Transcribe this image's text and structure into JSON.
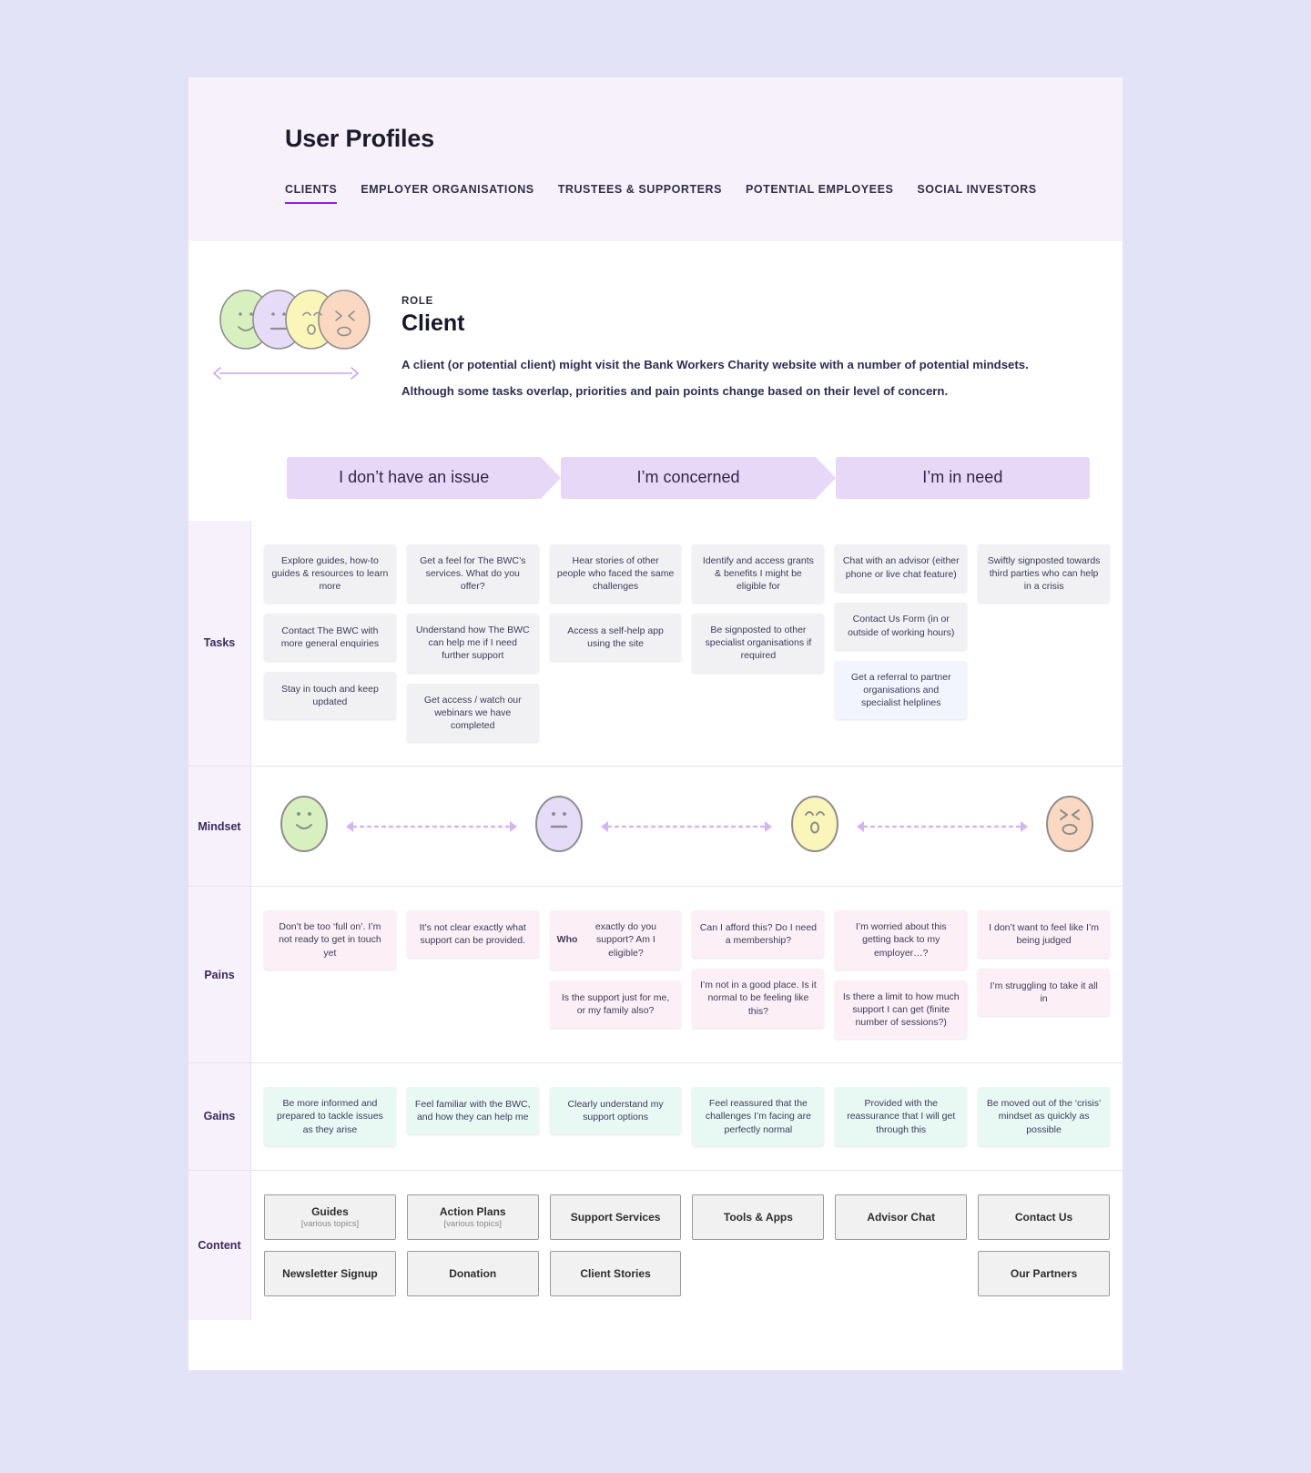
{
  "header": {
    "title": "User Profiles",
    "tabs": [
      {
        "label": "CLIENTS",
        "active": true
      },
      {
        "label": "EMPLOYER ORGANISATIONS",
        "active": false
      },
      {
        "label": "TRUSTEES & SUPPORTERS",
        "active": false
      },
      {
        "label": "POTENTIAL EMPLOYEES",
        "active": false
      },
      {
        "label": "SOCIAL INVESTORS",
        "active": false
      }
    ]
  },
  "role": {
    "kicker": "ROLE",
    "name": "Client",
    "description_line1": "A client (or potential client) might visit the Bank Workers Charity website with a number of potential mindsets.",
    "description_line2": "Although some tasks overlap, priorities and pain points change based on their level of concern."
  },
  "stages": [
    {
      "label": "I don’t have an issue"
    },
    {
      "label": "I’m concerned"
    },
    {
      "label": "I’m in need"
    }
  ],
  "rows": {
    "tasks_label": "Tasks",
    "mindset_label": "Mindset",
    "pains_label": "Pains",
    "gains_label": "Gains",
    "content_label": "Content"
  },
  "tasks": [
    [
      "Explore guides, how-to guides & resources to learn more",
      "Contact The BWC with more general enquiries",
      "Stay in touch and keep updated"
    ],
    [
      "Get a feel for The BWC’s services. What do you offer?",
      "Understand how The BWC can help me if I need further support",
      "Get access / watch our webinars we have completed"
    ],
    [
      "Hear stories of other people who faced the same challenges",
      "Access a self-help app using the site"
    ],
    [
      "Identify and access grants & benefits I might be eligible for",
      "Be signposted to other specialist organisations if required"
    ],
    [
      "Chat with an advisor (either phone or live chat feature)",
      "Contact Us Form (in or outside of working hours)",
      "Get a referral to partner organisations and specialist helplines"
    ],
    [
      "Swiftly signposted towards third parties who can help in a crisis"
    ]
  ],
  "mindset_faces": [
    {
      "name": "happy-face",
      "color": "#d8f0c0",
      "expression": "smiling"
    },
    {
      "name": "neutral-face",
      "color": "#e6dcf8",
      "expression": "neutral"
    },
    {
      "name": "worried-face",
      "color": "#faf5b8",
      "expression": "worried"
    },
    {
      "name": "distressed-face",
      "color": "#fbd8c2",
      "expression": "distressed"
    }
  ],
  "pains": [
    [
      "Don’t be too ‘full on’. I’m not ready to get in touch yet"
    ],
    [
      "It’s not clear exactly what support can be provided."
    ],
    [
      "<b>Who</b> exactly do you support? Am I eligible?",
      "Is the support just for me, or my family also?"
    ],
    [
      "Can I afford this? Do I need a membership?",
      "I’m not in a good place. Is it normal to be feeling like this?"
    ],
    [
      "I’m worried about this getting back to my employer…?",
      "Is there a limit to how much support I can get (finite number of sessions?)"
    ],
    [
      "I don’t want to feel like I’m being judged",
      "I’m struggling to take it all in"
    ]
  ],
  "gains": [
    [
      "Be more informed and prepared to tackle issues as they arise"
    ],
    [
      "Feel familiar with the BWC, and how they can help me"
    ],
    [
      "Clearly understand my support options"
    ],
    [
      "Feel reassured that the challenges I’m facing are perfectly normal"
    ],
    [
      "Provided with the reassurance that I will get through this"
    ],
    [
      "Be moved out of the ‘crisis’ mindset as quickly as possible"
    ]
  ],
  "content": [
    [
      {
        "title": "Guides",
        "sub": "[various topics]"
      },
      {
        "title": "Newsletter Signup",
        "sub": ""
      }
    ],
    [
      {
        "title": "Action Plans",
        "sub": "[various topics]"
      },
      {
        "title": "Donation",
        "sub": ""
      }
    ],
    [
      {
        "title": "Support Services",
        "sub": ""
      },
      {
        "title": "Client Stories",
        "sub": ""
      }
    ],
    [
      {
        "title": "Tools & Apps",
        "sub": ""
      }
    ],
    [
      {
        "title": "Advisor Chat",
        "sub": ""
      }
    ],
    [
      {
        "title": "Contact Us",
        "sub": ""
      },
      {
        "title": "Our Partners",
        "sub": ""
      }
    ]
  ],
  "colors": {
    "accent": "#8b1ef0",
    "header_bg": "#f7f1fc",
    "stage_bg": "#e8d8f8",
    "task_bg": "#f1f1f3",
    "pain_bg": "#fceff5",
    "gain_bg": "#e8f9f4",
    "content_border": "#9a9a9a",
    "row_label_bg": "#f7f1fb",
    "page_bg": "#e3e3f7"
  }
}
